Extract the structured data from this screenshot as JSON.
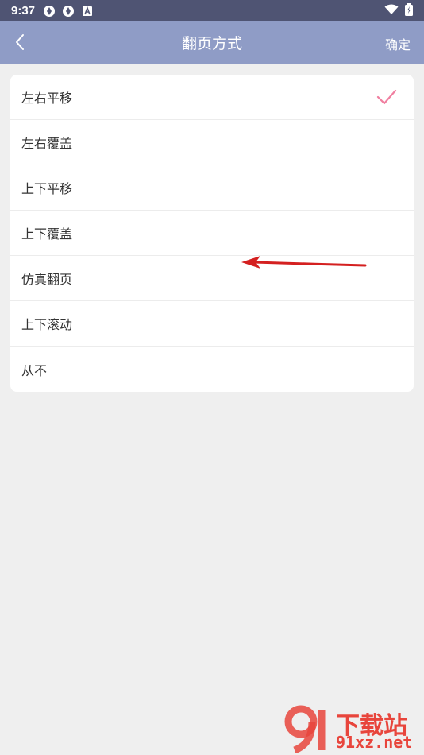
{
  "status_bar": {
    "time": "9:37"
  },
  "app_bar": {
    "title": "翻页方式",
    "confirm_label": "确定"
  },
  "options": [
    {
      "label": "左右平移",
      "selected": true
    },
    {
      "label": "左右覆盖",
      "selected": false
    },
    {
      "label": "上下平移",
      "selected": false
    },
    {
      "label": "上下覆盖",
      "selected": false
    },
    {
      "label": "仿真翻页",
      "selected": false
    },
    {
      "label": "上下滚动",
      "selected": false
    },
    {
      "label": "从不",
      "selected": false
    }
  ],
  "watermark": {
    "logo_text": "下载站",
    "domain_text": "91xz.net"
  },
  "colors": {
    "status_bar": "#4f5473",
    "app_bar": "#8f9cc6",
    "check": "#f07fa0",
    "annotation_arrow": "#d42020",
    "watermark": "#e8453c"
  }
}
